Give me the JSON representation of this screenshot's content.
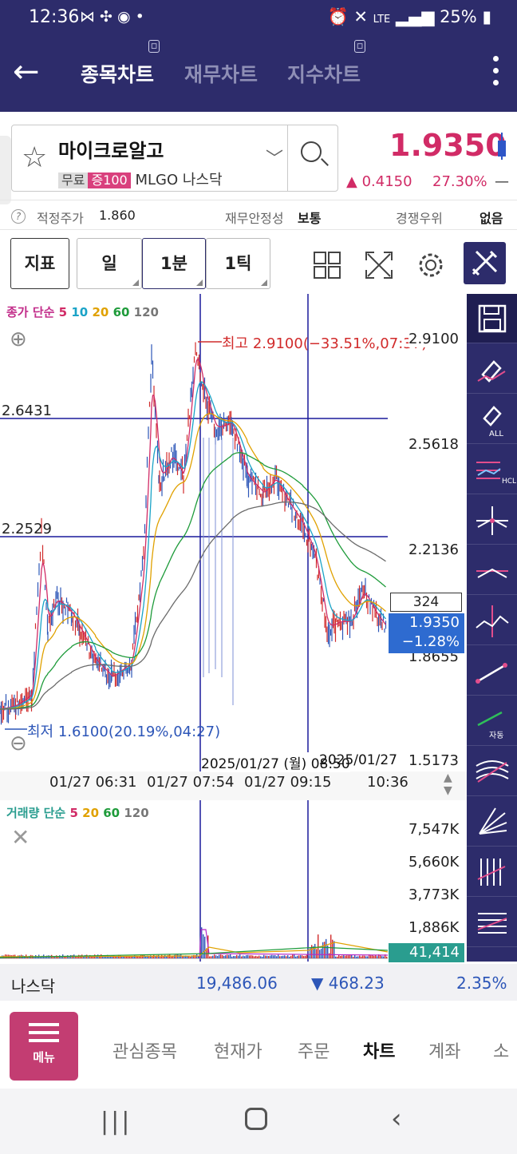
{
  "status": {
    "time": "12:36",
    "battery": "25%",
    "network": "LTE"
  },
  "header": {
    "tabs": [
      {
        "label": "종목차트"
      },
      {
        "label": "재무차트"
      },
      {
        "label": "지수차트"
      }
    ]
  },
  "stock": {
    "name": "마이크로알고",
    "tags": [
      "무료",
      "증100"
    ],
    "ticker": "MLGO",
    "market": "나스닥",
    "price": "1.9350",
    "change": "0.4150",
    "change_pct": "27.30%",
    "change_suffix": "—"
  },
  "info": {
    "fair_label": "적정주가",
    "fair_value": "1.860",
    "stability_label": "재무안정성",
    "stability_value": "보통",
    "compete_label": "경쟁우위",
    "compete_value": "없음"
  },
  "toolbar": {
    "indicator": "지표",
    "periods": [
      "일",
      "1분",
      "1틱"
    ],
    "selected_period": "1분"
  },
  "chart": {
    "legend_price_prefix": "종가 단순",
    "legend_price_ma": [
      "5",
      "10",
      "20",
      "60",
      "120"
    ],
    "legend_volume_prefix": "거래량 단순",
    "legend_volume_ma": [
      "5",
      "20",
      "60",
      "120"
    ],
    "count_box": "324",
    "high_note": "최고 2.9100(−33.51%,07:37)",
    "low_note": "최저 1.6100(20.19%,04:27)",
    "hline_labels": [
      "2.6431",
      "2.2529"
    ],
    "y_ticks": [
      "2.9100",
      "2.5618",
      "2.2136",
      "1.8655",
      "1.5173"
    ],
    "current_price": "1.9350",
    "current_pct": "−1.28%",
    "crosshair_date": "2025/01/27 (월) 08:50",
    "crosshair_date2": "2025/01/27",
    "x_ticks": [
      "01/27 06:31",
      "01/27 07:54",
      "01/27 09:15",
      "10:36"
    ],
    "vol_ticks": [
      "7,547K",
      "5,660K",
      "3,773K",
      "1,886K"
    ],
    "vol_current": "41,414",
    "colors": {
      "ma5": "#d12b66",
      "ma10": "#1aa3c7",
      "ma20": "#e0a100",
      "ma60": "#1e9b3a",
      "ma120": "#6b6b6b",
      "hline": "#1a1a9c"
    }
  },
  "index": {
    "name": "나스닥",
    "value": "19,486.06",
    "change": "468.23",
    "pct": "2.35%"
  },
  "bottomnav": {
    "menu": "메뉴",
    "items": [
      "관심종목",
      "현재가",
      "주문",
      "차트",
      "계좌",
      "소"
    ],
    "active": "차트"
  }
}
